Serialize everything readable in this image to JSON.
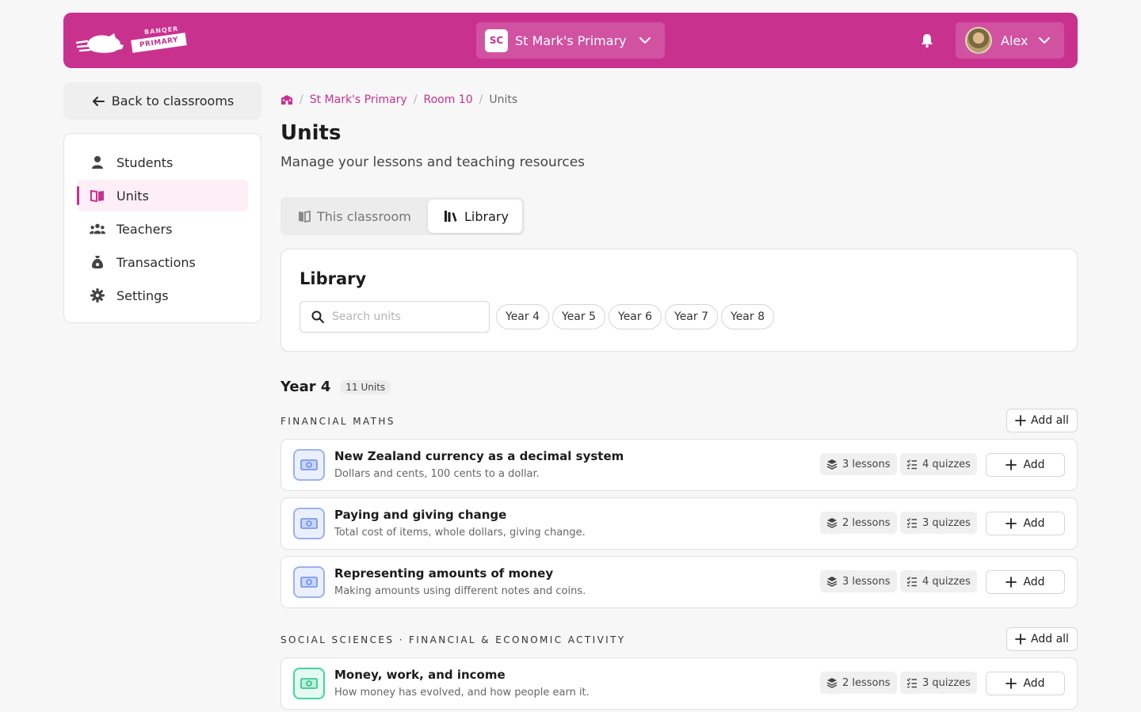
{
  "header": {
    "logo_line1": "BANQER",
    "logo_line2": "PRIMARY",
    "school": {
      "initials": "SC",
      "name": "St Mark's Primary"
    },
    "user": {
      "name": "Alex"
    }
  },
  "sidebar": {
    "back_label": "Back to classrooms",
    "items": [
      {
        "label": "Students",
        "icon": "person-icon"
      },
      {
        "label": "Units",
        "icon": "book-icon",
        "active": true
      },
      {
        "label": "Teachers",
        "icon": "users-icon"
      },
      {
        "label": "Transactions",
        "icon": "money-bag-icon"
      },
      {
        "label": "Settings",
        "icon": "gear-icon"
      }
    ]
  },
  "breadcrumb": [
    "St Mark's Primary",
    "Room 10",
    "Units"
  ],
  "page": {
    "title": "Units",
    "subtitle": "Manage your lessons and teaching resources"
  },
  "tabs": [
    {
      "label": "This classroom",
      "active": false
    },
    {
      "label": "Library",
      "active": true
    }
  ],
  "library": {
    "title": "Library",
    "search_placeholder": "Search units",
    "year_filters": [
      "Year 4",
      "Year 5",
      "Year 6",
      "Year 7",
      "Year 8"
    ]
  },
  "year_group": {
    "title": "Year 4",
    "count": "11 Units",
    "sections": [
      {
        "label": "FINANCIAL MATHS",
        "add_all_label": "Add all",
        "units": [
          {
            "title": "New Zealand currency as a decimal system",
            "description": "Dollars and cents, 100 cents to a dollar.",
            "lessons": "3 lessons",
            "quizzes": "4 quizzes",
            "add_label": "Add",
            "color": "blue"
          },
          {
            "title": "Paying and giving change",
            "description": "Total cost of items, whole dollars, giving change.",
            "lessons": "2 lessons",
            "quizzes": "3 quizzes",
            "add_label": "Add",
            "color": "blue"
          },
          {
            "title": "Representing amounts of money",
            "description": "Making amounts using different notes and coins.",
            "lessons": "3 lessons",
            "quizzes": "4 quizzes",
            "add_label": "Add",
            "color": "blue"
          }
        ]
      },
      {
        "label": "SOCIAL SCIENCES · FINANCIAL & ECONOMIC ACTIVITY",
        "add_all_label": "Add all",
        "units": [
          {
            "title": "Money, work, and income",
            "description": "How money has evolved, and how people earn it.",
            "lessons": "2 lessons",
            "quizzes": "3 quizzes",
            "add_label": "Add",
            "color": "green"
          }
        ]
      }
    ]
  },
  "colors": {
    "brand": "#c9318f",
    "unit_blue": "#6f8ee6",
    "unit_green": "#2cc08a"
  }
}
